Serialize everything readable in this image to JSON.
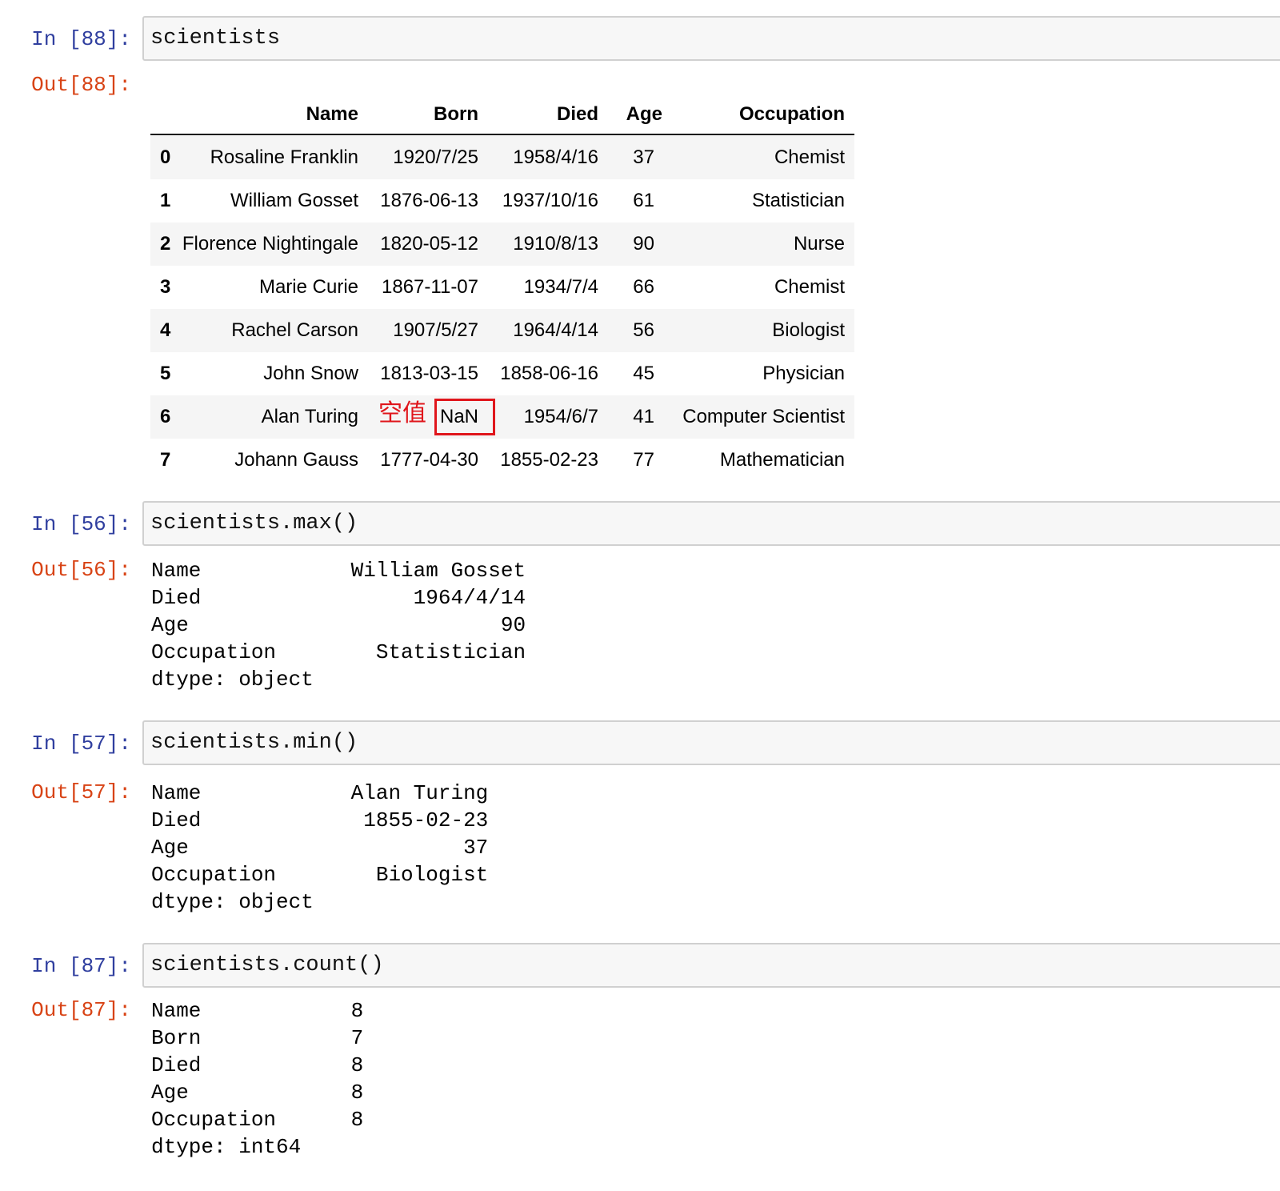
{
  "cells": [
    {
      "in_prompt": "In [88]:",
      "code": "scientists",
      "out_prompt": "Out[88]:"
    },
    {
      "in_prompt": "In [56]:",
      "code": "scientists.max()",
      "out_prompt": "Out[56]:",
      "output": "Name            William Gosset\nDied                 1964/4/14\nAge                         90\nOccupation        Statistician\ndtype: object"
    },
    {
      "in_prompt": "In [57]:",
      "code": "scientists.min()",
      "out_prompt": "Out[57]:",
      "output": "Name            Alan Turing\nDied             1855-02-23\nAge                      37\nOccupation        Biologist\ndtype: object"
    },
    {
      "in_prompt": "In [87]:",
      "code": "scientists.count()",
      "out_prompt": "Out[87]:",
      "output": "Name            8\nBorn            7\nDied            8\nAge             8\nOccupation      8\ndtype: int64"
    }
  ],
  "dataframe": {
    "columns": [
      "Name",
      "Born",
      "Died",
      "Age",
      "Occupation"
    ],
    "index": [
      "0",
      "1",
      "2",
      "3",
      "4",
      "5",
      "6",
      "7"
    ],
    "rows": [
      [
        "Rosaline Franklin",
        "1920/7/25",
        "1958/4/16",
        "37",
        "Chemist"
      ],
      [
        "William Gosset",
        "1876-06-13",
        "1937/10/16",
        "61",
        "Statistician"
      ],
      [
        "Florence Nightingale",
        "1820-05-12",
        "1910/8/13",
        "90",
        "Nurse"
      ],
      [
        "Marie Curie",
        "1867-11-07",
        "1934/7/4",
        "66",
        "Chemist"
      ],
      [
        "Rachel Carson",
        "1907/5/27",
        "1964/4/14",
        "56",
        "Biologist"
      ],
      [
        "John Snow",
        "1813-03-15",
        "1858-06-16",
        "45",
        "Physician"
      ],
      [
        "Alan Turing",
        "NaN",
        "1954/6/7",
        "41",
        "Computer Scientist"
      ],
      [
        "Johann Gauss",
        "1777-04-30",
        "1855-02-23",
        "77",
        "Mathematician"
      ]
    ]
  },
  "annotation": {
    "label": "空值",
    "color": "#e0161c"
  },
  "colors": {
    "in_prompt": "#303f9f",
    "out_prompt": "#d84315",
    "code_bg": "#f7f7f7",
    "stripe": "#f5f5f5"
  }
}
